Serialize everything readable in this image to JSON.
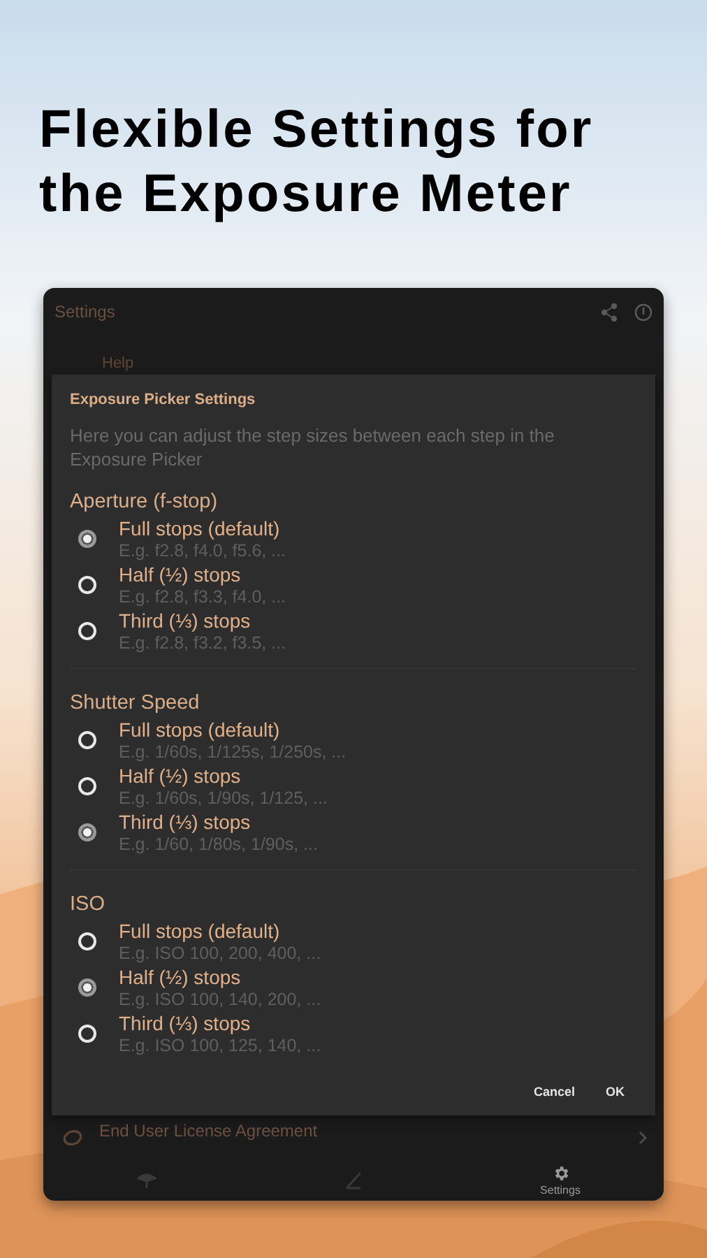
{
  "headline": "Flexible Settings for the Exposure Meter",
  "app_bar": {
    "title": "Settings"
  },
  "background_item": {
    "title": "Help"
  },
  "dialog": {
    "title": "Exposure Picker Settings",
    "description": "Here you can adjust the step sizes between each step in the Exposure Picker",
    "groups": [
      {
        "title": "Aperture (f-stop)",
        "options": [
          {
            "label": "Full stops (default)",
            "example": "E.g. f2.8, f4.0, f5.6, ...",
            "selected": true
          },
          {
            "label": "Half (½) stops",
            "example": "E.g. f2.8, f3.3, f4.0, ...",
            "selected": false
          },
          {
            "label": "Third (⅓) stops",
            "example": "E.g. f2.8, f3.2, f3.5, ...",
            "selected": false
          }
        ]
      },
      {
        "title": "Shutter Speed",
        "options": [
          {
            "label": "Full stops (default)",
            "example": "E.g. 1/60s, 1/125s, 1/250s, ...",
            "selected": false
          },
          {
            "label": "Half (½) stops",
            "example": "E.g. 1/60s, 1/90s, 1/125, ...",
            "selected": false
          },
          {
            "label": "Third (⅓) stops",
            "example": "E.g. 1/60, 1/80s, 1/90s, ...",
            "selected": true
          }
        ]
      },
      {
        "title": "ISO",
        "options": [
          {
            "label": "Full stops (default)",
            "example": "E.g. ISO 100, 200, 400, ...",
            "selected": false
          },
          {
            "label": "Half (½) stops",
            "example": "E.g. ISO 100, 140, 200, ...",
            "selected": true
          },
          {
            "label": "Third (⅓) stops",
            "example": "E.g. ISO 100, 125, 140, ...",
            "selected": false
          }
        ]
      }
    ],
    "buttons": [
      "Cancel",
      "OK"
    ]
  },
  "list_item": {
    "title": "End User License Agreement"
  },
  "bottom_nav": [
    {
      "kind": "home",
      "selected": false
    },
    {
      "kind": "exposure",
      "selected": false
    },
    {
      "kind": "settings",
      "label": "Settings",
      "selected": true
    }
  ]
}
